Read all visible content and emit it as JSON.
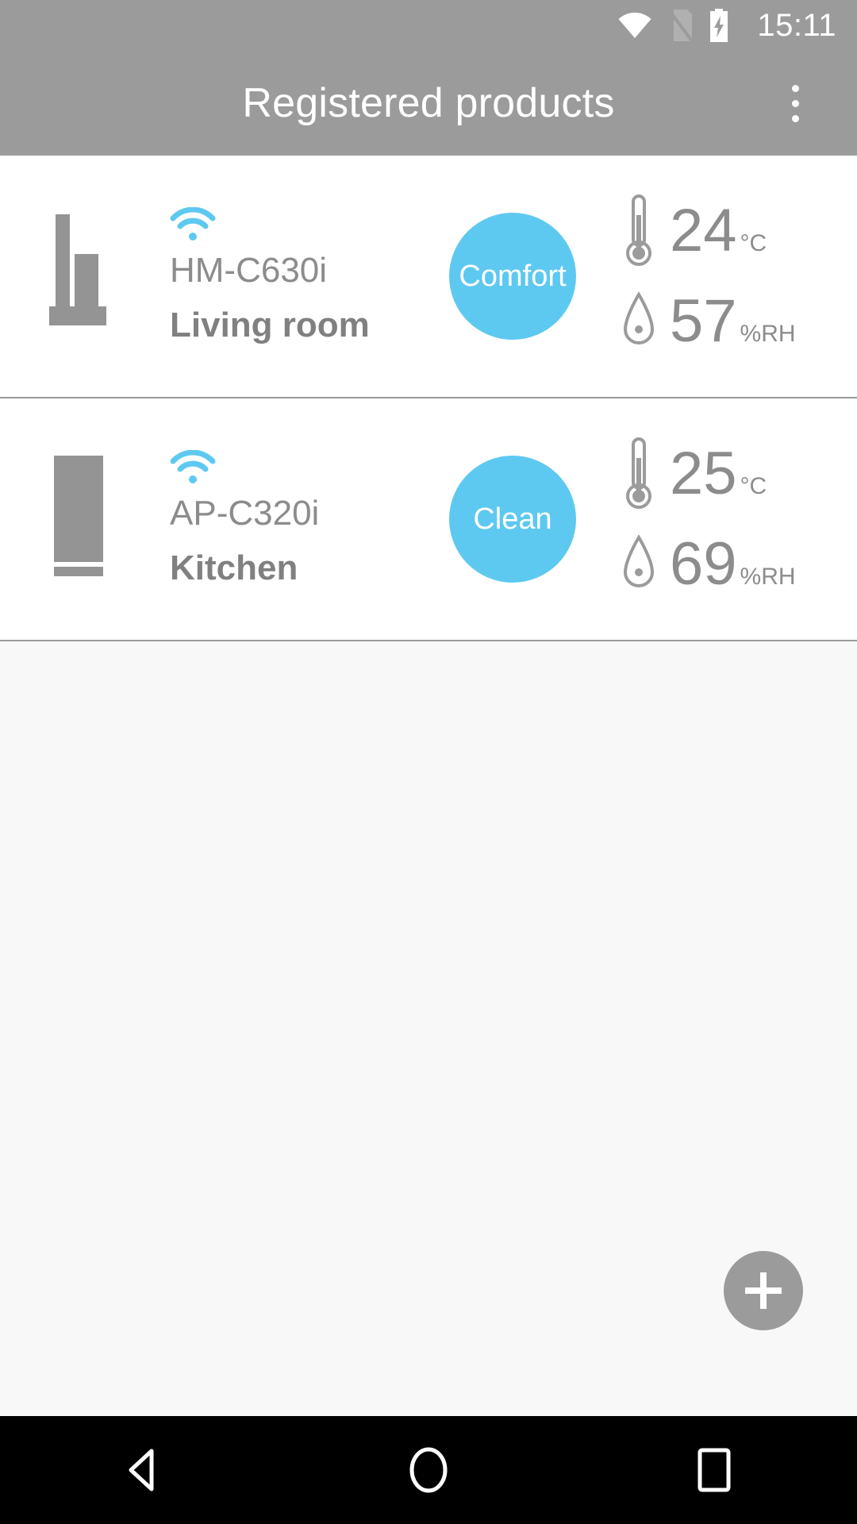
{
  "status_bar": {
    "time": "15:11",
    "icons": [
      {
        "name": "wifi-icon"
      },
      {
        "name": "no-sim-card-icon"
      },
      {
        "name": "battery-charging-icon"
      }
    ]
  },
  "app_bar": {
    "title": "Registered products",
    "overflow_menu": "more-options"
  },
  "colors": {
    "appbar_bg": "#9b9b9b",
    "accent_blue": "#5ec9f0",
    "wifi_blue": "#5ec9f0",
    "text_gray": "#8c8c8c",
    "fab_bg": "#9b9b9b",
    "navbar_bg": "#000000"
  },
  "products": [
    {
      "device_icon": "humidifier-icon",
      "connection_icon": "wifi-icon",
      "model": "HM-C630i",
      "room": "Living room",
      "status": "Comfort",
      "status_color": "#5ec9f0",
      "temperature": {
        "icon": "thermometer-icon",
        "value": "24",
        "unit": "°C"
      },
      "humidity": {
        "icon": "humidity-drop-icon",
        "value": "57",
        "unit": "%RH"
      }
    },
    {
      "device_icon": "air-purifier-icon",
      "connection_icon": "wifi-icon",
      "model": "AP-C320i",
      "room": "Kitchen",
      "status": "Clean",
      "status_color": "#5ec9f0",
      "temperature": {
        "icon": "thermometer-icon",
        "value": "25",
        "unit": "°C"
      },
      "humidity": {
        "icon": "humidity-drop-icon",
        "value": "69",
        "unit": "%RH"
      }
    }
  ],
  "fab": {
    "label": "+",
    "name": "add-product-button"
  },
  "nav_bar": {
    "buttons": [
      {
        "name": "nav-back-button",
        "icon": "back-triangle-icon"
      },
      {
        "name": "nav-home-button",
        "icon": "home-circle-icon"
      },
      {
        "name": "nav-recents-button",
        "icon": "recents-square-icon"
      }
    ]
  }
}
